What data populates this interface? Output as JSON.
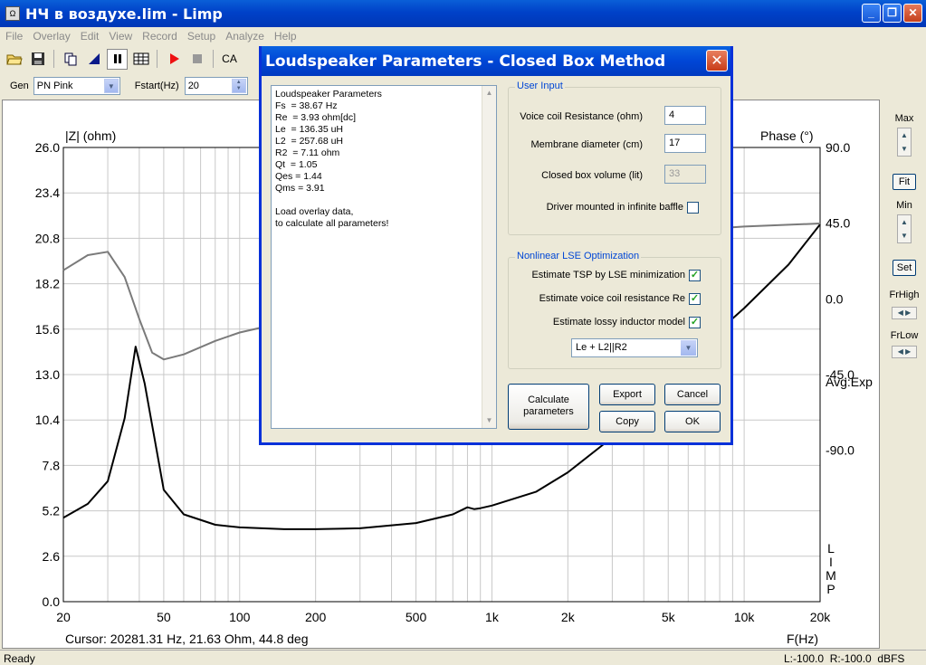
{
  "window": {
    "title": "НЧ в воздухе.lim - Limp",
    "icon": "limp-app-icon"
  },
  "menu": [
    "File",
    "Overlay",
    "Edit",
    "View",
    "Record",
    "Setup",
    "Analyze",
    "Help"
  ],
  "toolbar": {
    "cut_text": "CA"
  },
  "gen": {
    "label": "Gen",
    "value": "PN Pink",
    "fstart_label": "Fstart(Hz)",
    "fstart_value": "20"
  },
  "plot": {
    "left_axis_title": "|Z| (ohm)",
    "right_axis_title": "Phase (°)",
    "left_ticks": [
      "26.0",
      "23.4",
      "20.8",
      "18.2",
      "15.6",
      "13.0",
      "10.4",
      "7.8",
      "5.2",
      "2.6",
      "0.0"
    ],
    "right_ticks": [
      "90.0",
      "45.0",
      "0.0",
      "-45.0",
      "-90.0"
    ],
    "x_ticks": [
      "20",
      "50",
      "100",
      "200",
      "500",
      "1k",
      "2k",
      "5k",
      "10k",
      "20k"
    ],
    "xlabel": "F(Hz)",
    "avg_label": "Avg:Exp",
    "side_label": [
      "L",
      "I",
      "M",
      "P"
    ],
    "cursor": "Cursor: 20281.31 Hz, 21.63 Ohm, 44.8 deg"
  },
  "right_panel": {
    "max": "Max",
    "fit": "Fit",
    "min": "Min",
    "set": "Set",
    "frhigh": "FrHigh",
    "frlow": "FrLow"
  },
  "status": {
    "left": "Ready",
    "levels": "L:-100.0  R:-100.0  dBFS"
  },
  "dialog": {
    "title": "Loudspeaker Parameters - Closed Box Method",
    "results": [
      "Loudspeaker Parameters",
      "Fs  = 38.67 Hz",
      "Re  = 3.93 ohm[dc]",
      "Le  = 136.35 uH",
      "L2  = 257.68 uH",
      "R2  = 7.11 ohm",
      "Qt  = 1.05",
      "Qes = 1.44",
      "Qms = 3.91",
      "",
      "Load overlay data,",
      "to calculate all parameters!"
    ],
    "user_input": {
      "title": "User Input",
      "vc_label": "Voice coil Resistance (ohm)",
      "vc_value": "4",
      "md_label": "Membrane diameter (cm)",
      "md_value": "17",
      "cb_label": "Closed box volume (lit)",
      "cb_value": "33",
      "baffle_label": "Driver mounted in infinite baffle",
      "baffle_checked": false
    },
    "lse": {
      "title": "Nonlinear LSE Optimization",
      "tsp_label": "Estimate TSP by LSE minimization",
      "tsp": true,
      "re_label": "Estimate voice coil resistance Re",
      "re": true,
      "li_label": "Estimate lossy inductor model",
      "li": true,
      "model": "Le + L2||R2"
    },
    "buttons": {
      "calculate": "Calculate parameters",
      "export": "Export",
      "cancel": "Cancel",
      "copy": "Copy",
      "ok": "OK"
    }
  },
  "chart_data": {
    "type": "line",
    "xlabel": "F(Hz)",
    "x_scale": "log",
    "xlim": [
      20,
      20000
    ],
    "ylabel": "|Z| (ohm)",
    "ylim": [
      0,
      26
    ],
    "y2label": "Phase (°)",
    "y2lim": [
      -180,
      90
    ],
    "grid": true,
    "series": [
      {
        "axis": "left",
        "color": "#000000",
        "x": [
          20,
          25,
          30,
          35,
          38.67,
          42,
          50,
          60,
          80,
          100,
          150,
          200,
          300,
          500,
          700,
          800,
          850,
          900,
          1000,
          1500,
          2000,
          3000,
          5000,
          7000,
          10000,
          15000,
          20000
        ],
        "y": [
          4.8,
          5.6,
          6.9,
          10.5,
          14.6,
          12.5,
          6.4,
          5.0,
          4.4,
          4.25,
          4.15,
          4.15,
          4.2,
          4.5,
          5.0,
          5.4,
          5.3,
          5.35,
          5.5,
          6.3,
          7.4,
          9.4,
          11.6,
          14.8,
          16.8,
          19.3,
          21.6
        ]
      },
      {
        "axis": "right",
        "color": "#7a7a7a",
        "x": [
          20,
          25,
          30,
          35,
          40,
          45,
          50,
          60,
          80,
          100,
          150,
          200,
          300,
          500,
          1000,
          2000,
          5000,
          10000,
          20000
        ],
        "y": [
          17,
          26,
          28,
          13,
          -12,
          -32,
          -36,
          -33,
          -25,
          -20,
          -14,
          -8,
          -2,
          8,
          20,
          32,
          40,
          43,
          44.8
        ]
      }
    ]
  }
}
